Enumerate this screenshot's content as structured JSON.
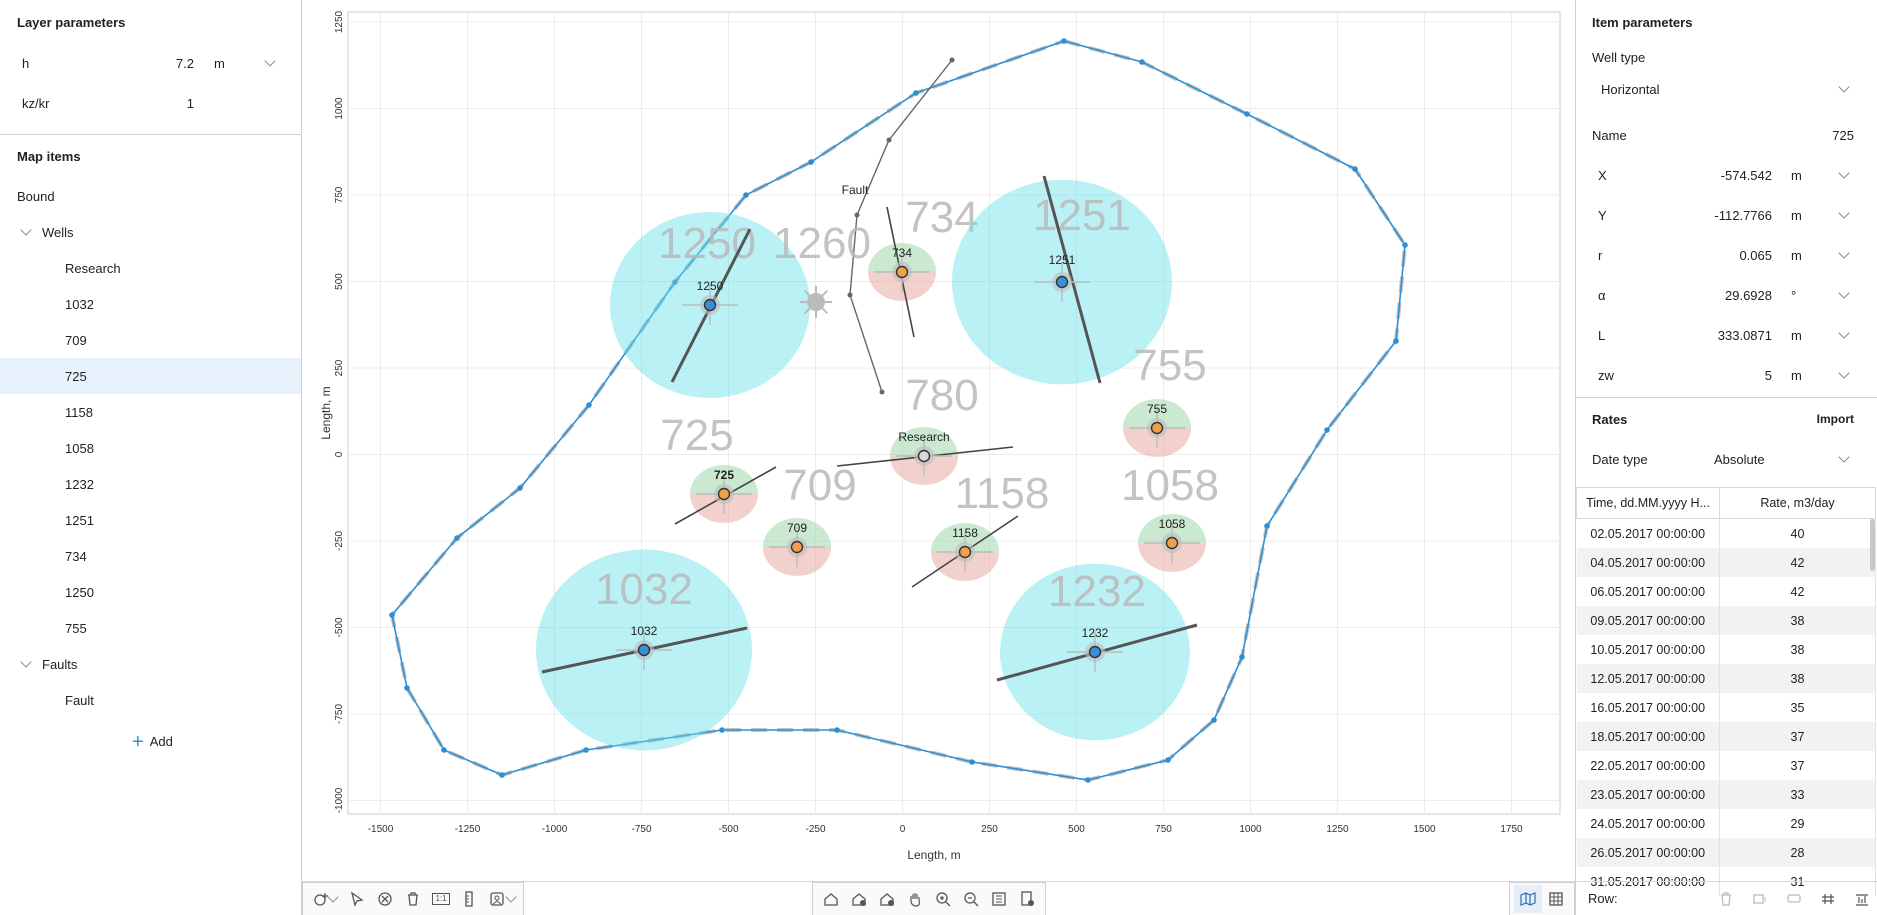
{
  "left": {
    "layer_title": "Layer parameters",
    "params": [
      {
        "label": "h",
        "value": "7.2",
        "unit": "m"
      },
      {
        "label": "kz/kr",
        "value": "1",
        "unit": ""
      }
    ],
    "map_items_title": "Map items",
    "bound_label": "Bound",
    "wells_label": "Wells",
    "wells": [
      "Research",
      "1032",
      "709",
      "725",
      "1158",
      "1058",
      "1232",
      "1251",
      "734",
      "1250",
      "755"
    ],
    "selected_well": "725",
    "faults_label": "Faults",
    "faults": [
      "Fault"
    ],
    "add_label": "Add"
  },
  "map": {
    "xlabel": "Length, m",
    "ylabel": "Length, m",
    "xticks": [
      "-1500",
      "-1250",
      "-1000",
      "-750",
      "-500",
      "-250",
      "0",
      "250",
      "500",
      "750",
      "1000",
      "1250",
      "1500",
      "1750"
    ],
    "yticks": [
      "1250",
      "1000",
      "750",
      "500",
      "250",
      "0",
      "-250",
      "-500",
      "-750",
      "-1000"
    ],
    "wells": [
      {
        "name": "1250",
        "label": "1250",
        "big": "1250"
      },
      {
        "name": "1260",
        "label": "",
        "big": "1260"
      },
      {
        "name": "734",
        "label": "734",
        "big": "734"
      },
      {
        "name": "1251",
        "label": "1251",
        "big": "1251"
      },
      {
        "name": "780",
        "label": "Research",
        "big": "780"
      },
      {
        "name": "755",
        "label": "755",
        "big": "755"
      },
      {
        "name": "725",
        "label": "725",
        "big": "725"
      },
      {
        "name": "709",
        "label": "709",
        "big": "709"
      },
      {
        "name": "1158",
        "label": "1158",
        "big": "1158"
      },
      {
        "name": "1058",
        "label": "1058",
        "big": "1058"
      },
      {
        "name": "1032",
        "label": "1032",
        "big": "1032"
      },
      {
        "name": "1232",
        "label": "1232",
        "big": "1232"
      }
    ],
    "fault_label": "Fault",
    "colors": {
      "boundary": "#2b8fd6",
      "influence": "#66e0e8",
      "producer": "#f0a04b",
      "injector": "#3a8fd6"
    }
  },
  "toolbar": {
    "left_icons": [
      "add-shape-icon",
      "chevron-down-icon",
      "select-pointer-icon",
      "cancel-circle-icon",
      "delete-trash-icon",
      "scale-1-1-icon",
      "ruler-icon",
      "image-icon",
      "chevron-down-icon"
    ],
    "scale_text": "1:1",
    "center_icons": [
      "home-icon",
      "add-layer-icon",
      "remove-layer-icon",
      "pan-hand-icon",
      "zoom-in-icon",
      "zoom-out-icon",
      "list-icon",
      "export-icon"
    ],
    "right_icons": [
      "map-view-icon",
      "table-view-icon"
    ]
  },
  "right": {
    "item_title": "Item parameters",
    "well_type_label": "Well type",
    "well_type_value": "Horizontal",
    "name_label": "Name",
    "name_value": "725",
    "params": [
      {
        "label": "X",
        "value": "-574.542",
        "unit": "m"
      },
      {
        "label": "Y",
        "value": "-112.7766",
        "unit": "m"
      },
      {
        "label": "r",
        "value": "0.065",
        "unit": "m"
      },
      {
        "label": "α",
        "value": "29.6928",
        "unit": "°"
      },
      {
        "label": "L",
        "value": "333.0871",
        "unit": "m"
      },
      {
        "label": "zw",
        "value": "5",
        "unit": "m"
      }
    ],
    "rates_title": "Rates",
    "import_label": "Import",
    "date_type_label": "Date type",
    "date_type_value": "Absolute",
    "col_time": "Time, dd.MM.yyyy H...",
    "col_rate": "Rate, m3/day",
    "rows": [
      [
        "02.05.2017 00:00:00",
        "40"
      ],
      [
        "04.05.2017 00:00:00",
        "42"
      ],
      [
        "06.05.2017 00:00:00",
        "42"
      ],
      [
        "09.05.2017 00:00:00",
        "38"
      ],
      [
        "10.05.2017 00:00:00",
        "38"
      ],
      [
        "12.05.2017 00:00:00",
        "38"
      ],
      [
        "16.05.2017 00:00:00",
        "35"
      ],
      [
        "18.05.2017 00:00:00",
        "37"
      ],
      [
        "22.05.2017 00:00:00",
        "37"
      ],
      [
        "23.05.2017 00:00:00",
        "33"
      ],
      [
        "24.05.2017 00:00:00",
        "29"
      ],
      [
        "26.05.2017 00:00:00",
        "28"
      ],
      [
        "31.05.2017 00:00:00",
        "31"
      ]
    ],
    "row_label": "Row:"
  }
}
